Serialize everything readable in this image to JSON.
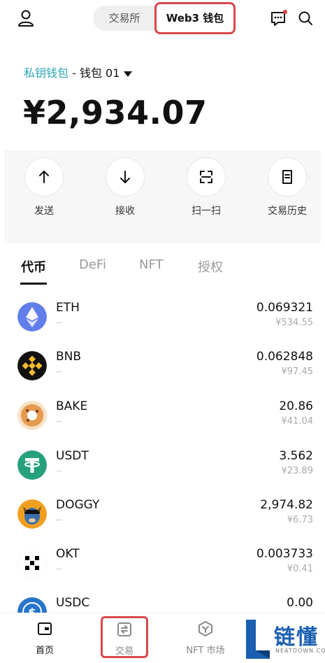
{
  "header": {
    "segment_options": [
      "交易所",
      "Web3 钱包"
    ],
    "selected_segment": "Web3 钱包"
  },
  "wallet": {
    "type": "私钥钱包",
    "separator": " - ",
    "name": "钱包 01",
    "balance": "¥2,934.07"
  },
  "actions": [
    {
      "label": "发送",
      "icon": "arrow-up-icon"
    },
    {
      "label": "接收",
      "icon": "arrow-down-icon"
    },
    {
      "label": "扫一扫",
      "icon": "scan-icon"
    },
    {
      "label": "交易历史",
      "icon": "history-icon"
    }
  ],
  "tabs": [
    {
      "label": "代币",
      "active": true
    },
    {
      "label": "DeFi",
      "active": false
    },
    {
      "label": "NFT",
      "active": false
    },
    {
      "label": "授权",
      "active": false
    }
  ],
  "tokens": [
    {
      "symbol": "ETH",
      "sub": "--",
      "amount": "0.069321",
      "value": "¥534.55",
      "color": "#627eea"
    },
    {
      "symbol": "BNB",
      "sub": "--",
      "amount": "0.062848",
      "value": "¥97.45",
      "color": "#111111"
    },
    {
      "symbol": "BAKE",
      "sub": "--",
      "amount": "20.86",
      "value": "¥41.04",
      "color": "#f2a65a"
    },
    {
      "symbol": "USDT",
      "sub": "--",
      "amount": "3.562",
      "value": "¥23.89",
      "color": "#26a17b"
    },
    {
      "symbol": "DOGGY",
      "sub": "--",
      "amount": "2,974.82",
      "value": "¥6.73",
      "color": "#f0a020"
    },
    {
      "symbol": "OKT",
      "sub": "--",
      "amount": "0.003733",
      "value": "¥0.41",
      "color": "#000000"
    },
    {
      "symbol": "USDC",
      "sub": "--",
      "amount": "0.00",
      "value": "",
      "color": "#2775ca"
    }
  ],
  "bottom_nav": [
    {
      "label": "首页",
      "icon": "home-icon",
      "active": true
    },
    {
      "label": "交易",
      "icon": "trade-icon",
      "active": false
    },
    {
      "label": "NFT 市场",
      "icon": "nft-market-icon",
      "active": false
    }
  ],
  "watermark": {
    "name": "链懂",
    "en": "NEATDOWN.COM"
  },
  "colors": {
    "accent": "#2aa6b8",
    "highlight": "#d9474a"
  }
}
